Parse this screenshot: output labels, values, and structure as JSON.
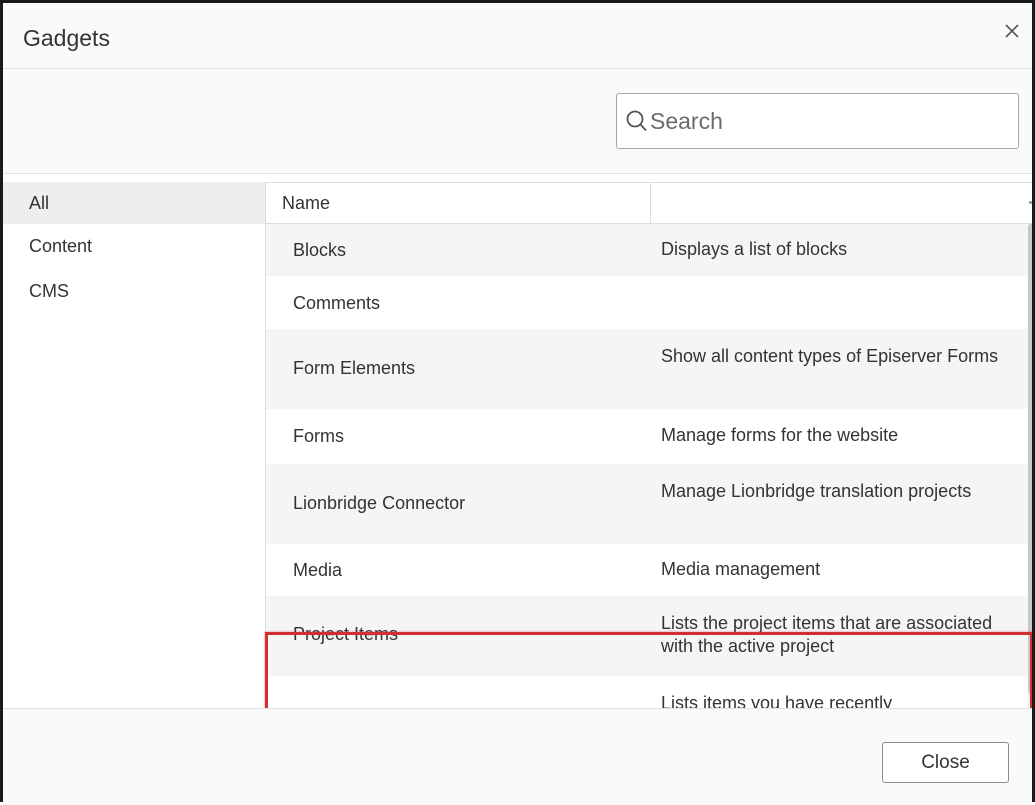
{
  "dialog": {
    "title": "Gadgets"
  },
  "search": {
    "placeholder": "Search",
    "value": ""
  },
  "sidebar": {
    "items": [
      {
        "label": "All",
        "active": true
      },
      {
        "label": "Content",
        "active": false
      },
      {
        "label": "CMS",
        "active": false
      }
    ]
  },
  "grid": {
    "columns": [
      "Name",
      ""
    ],
    "rows": [
      {
        "name": "Blocks",
        "description": "Displays a list of blocks"
      },
      {
        "name": "Comments",
        "description": ""
      },
      {
        "name": "Form Elements",
        "description": "Show all content types of Episerver Forms"
      },
      {
        "name": "Forms",
        "description": "Manage forms for the website"
      },
      {
        "name": "Lionbridge Connector",
        "description": "Manage Lionbridge translation projects"
      },
      {
        "name": "Media",
        "description": "Media management"
      },
      {
        "name": "Project Items",
        "description": "Lists the project items that are associated with the active project"
      },
      {
        "name": "",
        "description": "Lists items you have recently"
      }
    ],
    "highlighted_row": "Lionbridge Connector"
  },
  "footer": {
    "close_label": "Close"
  },
  "icons": {
    "close": "close-icon",
    "search": "search-icon"
  },
  "colors": {
    "highlight": "#d32f2f",
    "alt_row": "#f5f5f5",
    "selected_sidebar": "#eeeeee"
  }
}
